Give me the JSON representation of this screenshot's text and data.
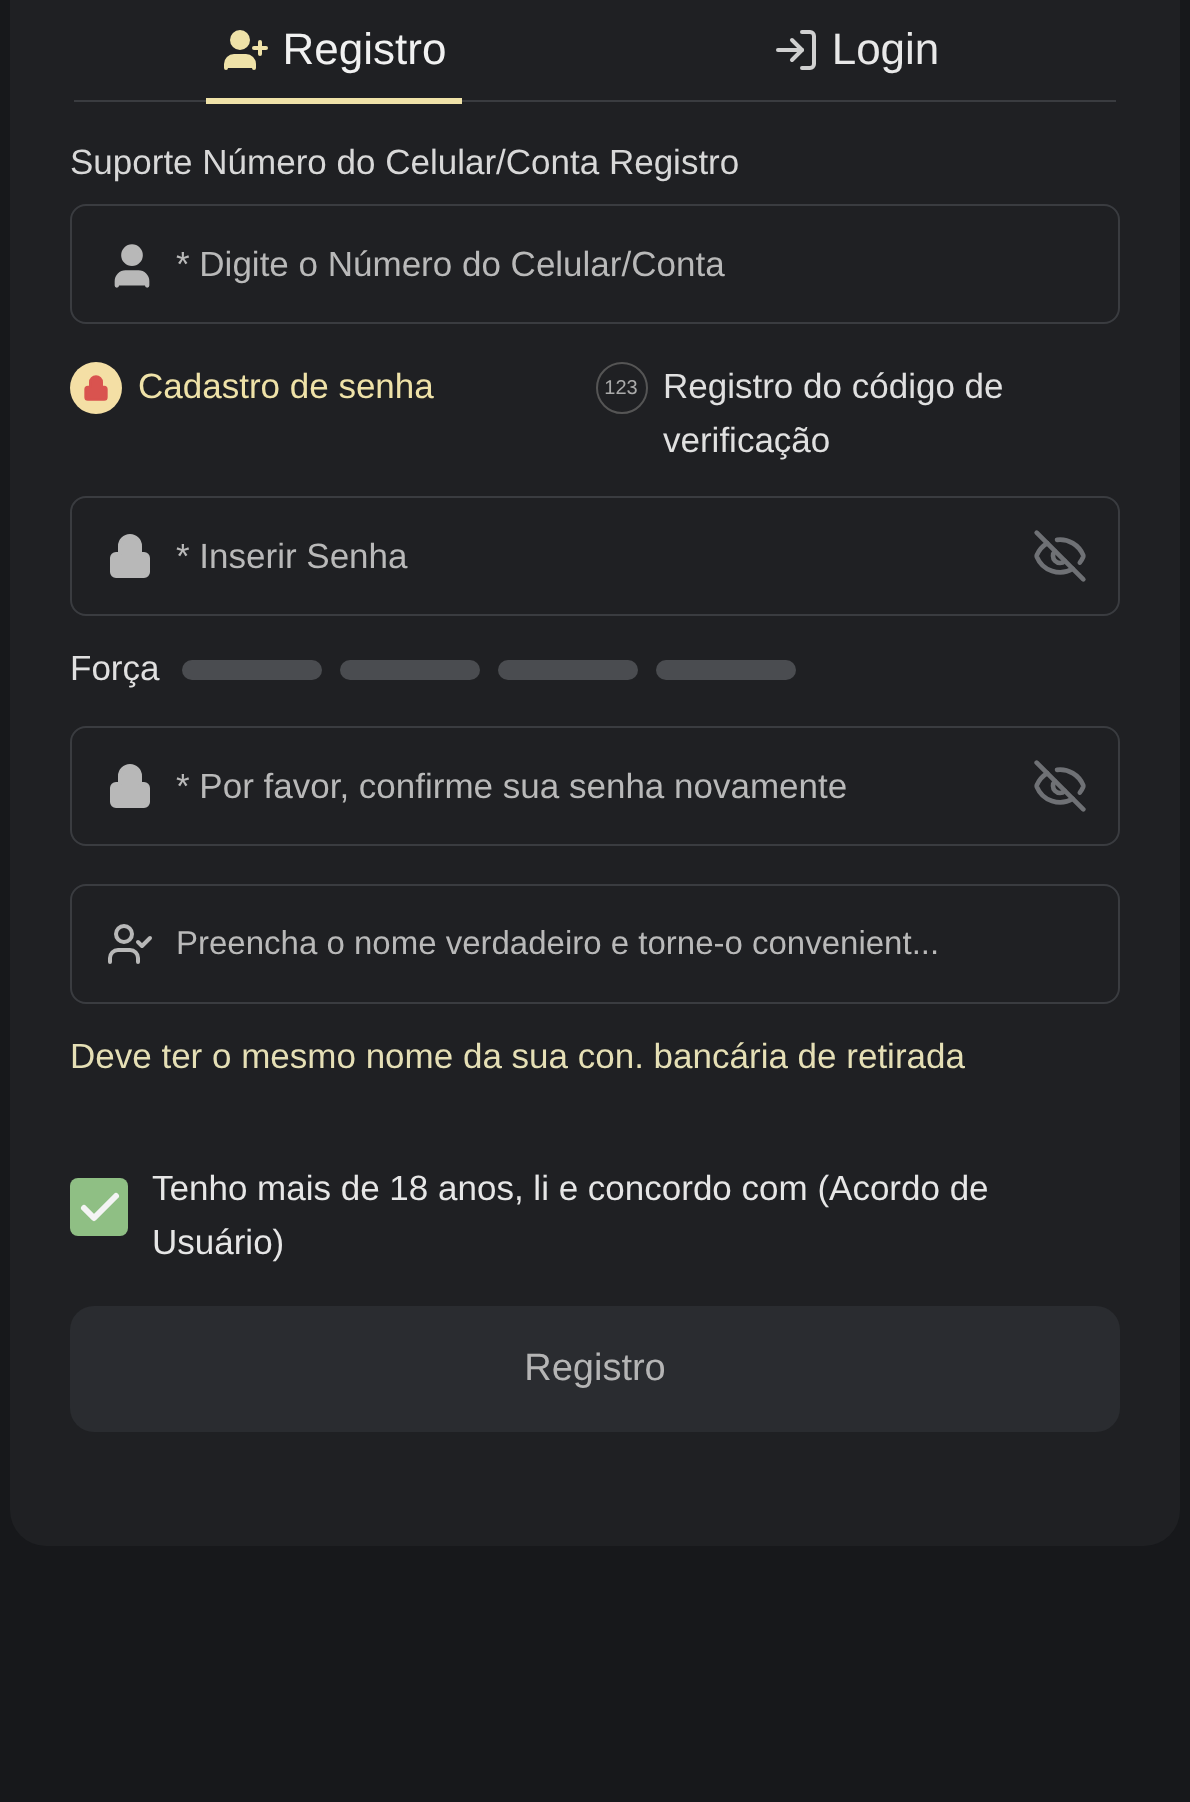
{
  "tabs": [
    {
      "label": "Registro",
      "selected": true,
      "kind": "register"
    },
    {
      "label": "Login",
      "selected": false,
      "kind": "login"
    }
  ],
  "support_label": "Suporte Número do Celular/Conta Registro",
  "account_field": {
    "placeholder": "* Digite o Número do Celular/Conta"
  },
  "methods": [
    {
      "label": "Cadastro de senha",
      "selected": true,
      "kind": "password"
    },
    {
      "label": "Registro do código de verificação",
      "selected": false,
      "kind": "code",
      "icon_text": "123"
    }
  ],
  "password_field": {
    "placeholder": "* Inserir Senha"
  },
  "strength": {
    "label": "Força"
  },
  "confirm_field": {
    "placeholder": "* Por favor, confirme sua senha novamente"
  },
  "name_field": {
    "placeholder": "Preencha o nome verdadeiro e torne-o convenient..."
  },
  "name_hint": "Deve ter o mesmo nome da sua con. bancária de retirada",
  "agreement": {
    "text": "Tenho mais de 18 anos, li e concordo com  (Acordo de Usuário)",
    "checked": true
  },
  "submit": {
    "label": "Registro",
    "disabled": true
  }
}
